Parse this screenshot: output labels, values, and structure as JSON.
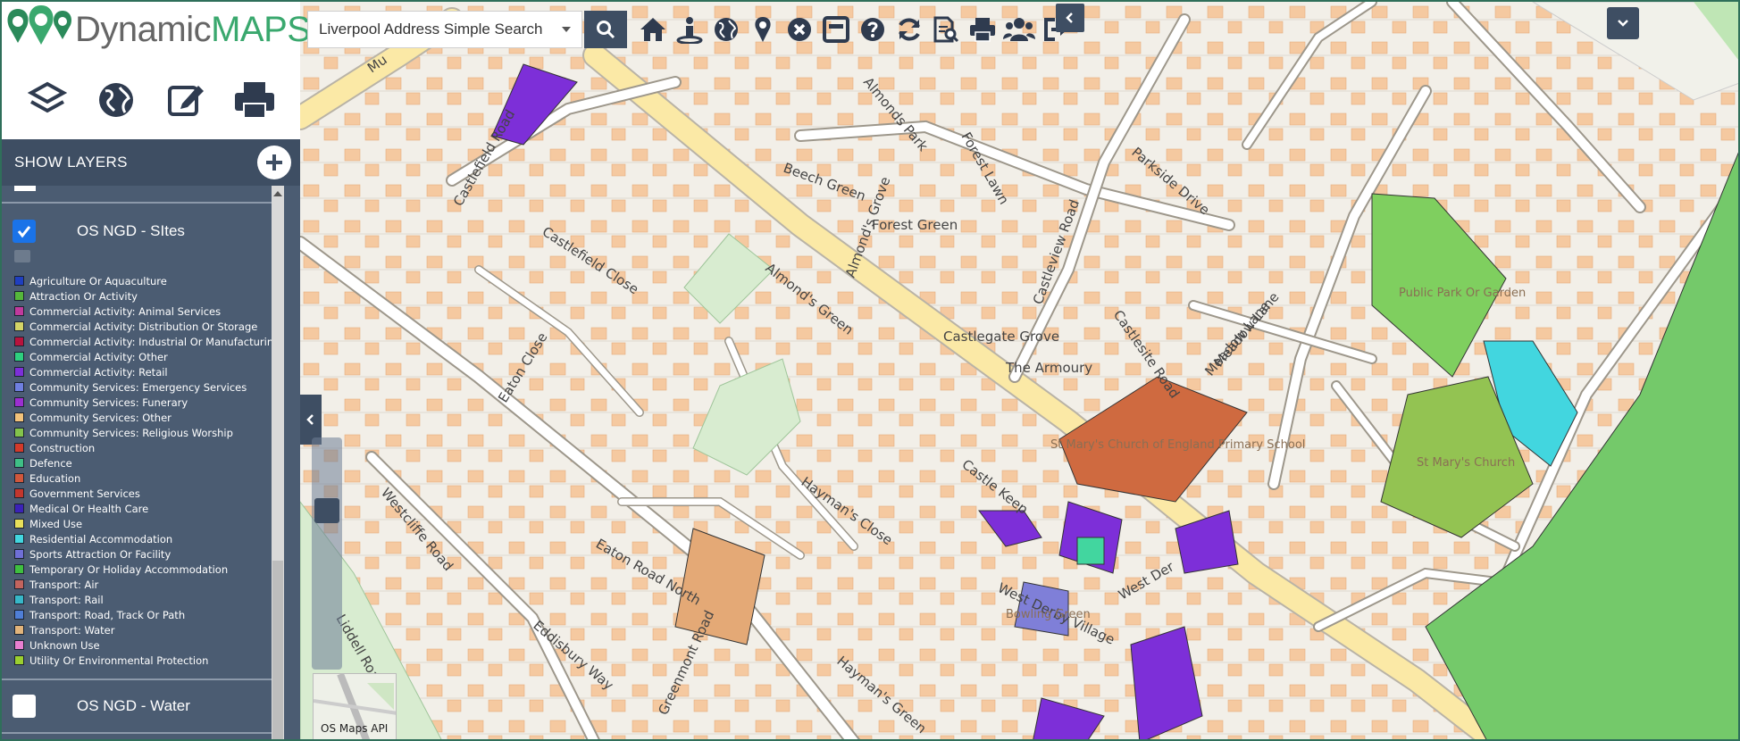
{
  "app": {
    "logo_part1": "Dynamic",
    "logo_part2": "MAPS"
  },
  "search": {
    "selected": "Liverpool Address Simple Search"
  },
  "toolbar": {
    "icons": [
      "home-icon",
      "info-person-icon",
      "globe-icon",
      "map-marker-icon",
      "clear-icon",
      "window-icon",
      "help-icon",
      "refresh-icon",
      "report-icon",
      "print-icon",
      "users-icon",
      "sign-out-icon"
    ]
  },
  "panel": {
    "tools": [
      "layers-icon",
      "globe-icon",
      "edit-icon",
      "print-icon"
    ],
    "show_layers": "SHOW LAYERS",
    "groups": [
      {
        "name": "OS NGD - SItes",
        "checked": true
      },
      {
        "name": "OS NGD - Water",
        "checked": false
      }
    ],
    "legend": [
      {
        "label": "Agriculture Or Aquaculture",
        "color": "#1f3fbf"
      },
      {
        "label": "Attraction Or Activity",
        "color": "#55b73b"
      },
      {
        "label": "Commercial Activity: Animal Services",
        "color": "#c03a9d"
      },
      {
        "label": "Commercial Activity: Distribution Or Storage",
        "color": "#d4d467"
      },
      {
        "label": "Commercial Activity: Industrial Or Manufacturing",
        "color": "#b8133d"
      },
      {
        "label": "Commercial Activity: Other",
        "color": "#2ecf7f"
      },
      {
        "label": "Commercial Activity: Retail",
        "color": "#7d2fd8"
      },
      {
        "label": "Community Services: Emergency Services",
        "color": "#6f7fe0"
      },
      {
        "label": "Community Services: Funerary",
        "color": "#9c2fd0"
      },
      {
        "label": "Community Services: Other",
        "color": "#f2c27a"
      },
      {
        "label": "Community Services: Religious Worship",
        "color": "#83c34b"
      },
      {
        "label": "Construction",
        "color": "#d33a2a"
      },
      {
        "label": "Defence",
        "color": "#3fbf86"
      },
      {
        "label": "Education",
        "color": "#d0573c"
      },
      {
        "label": "Government Services",
        "color": "#c2362d"
      },
      {
        "label": "Medical Or Health Care",
        "color": "#3b22b8"
      },
      {
        "label": "Mixed Use",
        "color": "#e8e05a"
      },
      {
        "label": "Residential Accommodation",
        "color": "#42d6df"
      },
      {
        "label": "Sports Attraction Or Facility",
        "color": "#6f6fd6"
      },
      {
        "label": "Temporary Or Holiday Accommodation",
        "color": "#3fbf3f"
      },
      {
        "label": "Transport: Air",
        "color": "#c2645e"
      },
      {
        "label": "Transport: Rail",
        "color": "#37b7c8"
      },
      {
        "label": "Transport: Road, Track Or Path",
        "color": "#4f7ed6"
      },
      {
        "label": "Transport: Water",
        "color": "#e2b47b"
      },
      {
        "label": "Unknown Use",
        "color": "#e87fd0"
      },
      {
        "label": "Utility Or Environmental Protection",
        "color": "#9bcf2f"
      }
    ]
  },
  "map": {
    "attribution": "OS Maps API",
    "streets": [
      "Almond's Green",
      "Castlefield Road",
      "Castlefield Close",
      "Eaton Close",
      "Westcliffe Road",
      "Liddell Road",
      "Eaton Road North",
      "Eddisbury Way",
      "Greenmont Road",
      "Hayman's Green",
      "Hayman's Close",
      "Castle Keep",
      "West Derby Village",
      "West Der",
      "Castleview Road",
      "Castlegate Grove",
      "The Armoury",
      "Forest Green",
      "Almond's Grove",
      "Beech Green",
      "Forest Lawn",
      "Almonds Park",
      "Parkside Drive",
      "Castlesite Road",
      "Meadow Lane",
      "Meadow Lane",
      "Mu"
    ],
    "places": [
      "Public Park Or Garden",
      "St Mary's Church of England Primary School",
      "St Mary's Church",
      "Bowling Green"
    ]
  }
}
